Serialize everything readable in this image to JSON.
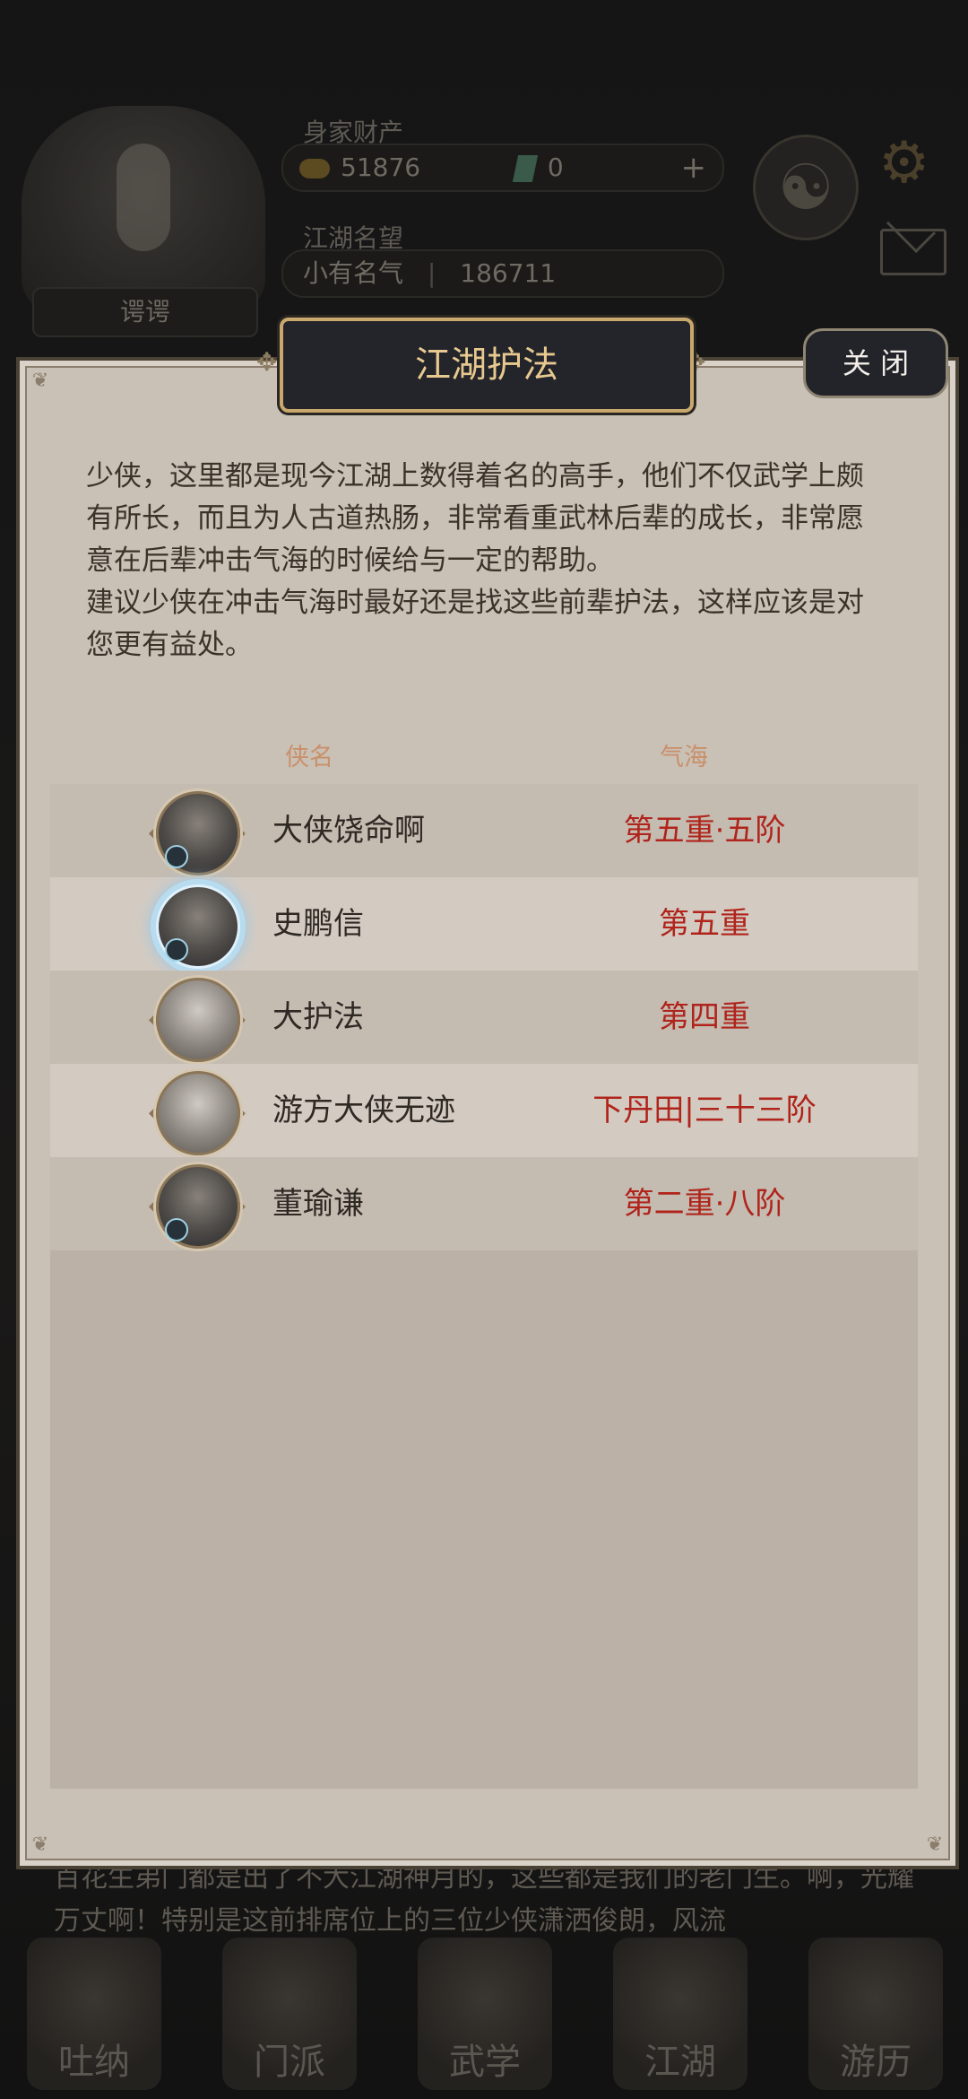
{
  "background": {
    "player_name": "谔谔",
    "wealth_label": "身家财产",
    "coins": "51876",
    "gems": "0",
    "plus_symbol": "+",
    "reputation_label": "江湖名望",
    "reputation_title": "小有名气",
    "reputation_value": "186711",
    "ticker": "百花生弟门都是出了不大江湖神月的，这些都是我们的老门生。啊，光耀万丈啊！特别是这前排席位上的三位少侠潇洒俊朗，风流",
    "nav": [
      "吐纳",
      "门派",
      "武学",
      "江湖",
      "游历"
    ]
  },
  "dialog": {
    "title": "江湖护法",
    "close_label": "关 闭",
    "intro_p1": "少侠，这里都是现今江湖上数得着名的高手，他们不仅武学上颇有所长，而且为人古道热肠，非常看重武林后辈的成长，非常愿意在后辈冲击气海的时候给与一定的帮助。",
    "intro_p2": "建议少侠在冲击气海时最好还是找这些前辈护法，这样应该是对您更有益处。",
    "columns": {
      "name": "侠名",
      "level": "气海"
    },
    "rows": [
      {
        "name": "大侠饶命啊",
        "level": "第五重·五阶"
      },
      {
        "name": "史鹏信",
        "level": "第五重"
      },
      {
        "name": "大护法",
        "level": "第四重"
      },
      {
        "name": "游方大侠无迹",
        "level": "下丹田|三十三阶"
      },
      {
        "name": "董瑜谦",
        "level": "第二重·八阶"
      }
    ]
  }
}
